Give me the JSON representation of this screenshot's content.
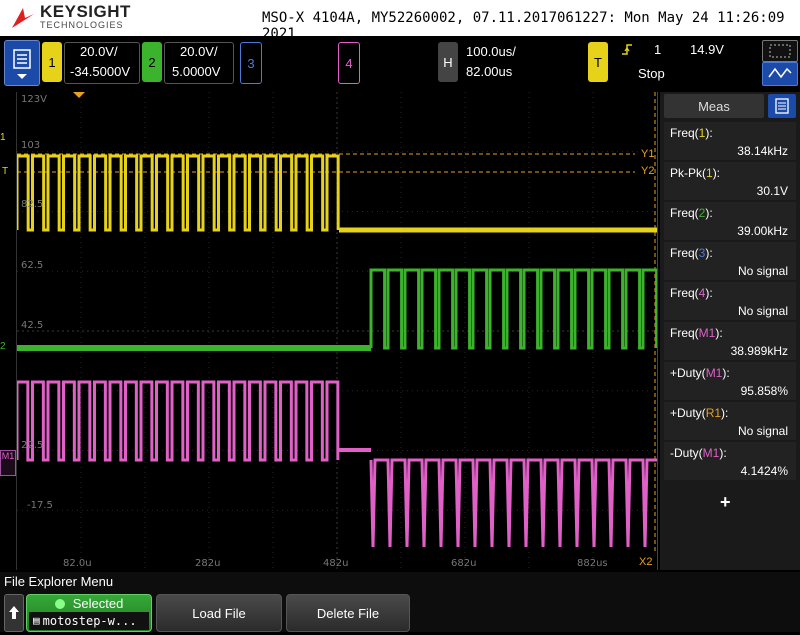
{
  "header": {
    "brand": "KEYSIGHT",
    "brand_sub": "TECHNOLOGIES",
    "instrument": "MSO-X 4104A, MY52260002, 07.11.2017061227: Mon May 24 11:26:09 2021"
  },
  "channels": [
    {
      "num": "1",
      "scale": "20.0V/",
      "offset": "-34.5000V",
      "color": "#e7d21a"
    },
    {
      "num": "2",
      "scale": "20.0V/",
      "offset": "5.0000V",
      "color": "#3cb32c"
    },
    {
      "num": "3",
      "color": "#4a7bd6"
    },
    {
      "num": "4",
      "color": "#e060c8"
    }
  ],
  "horizontal": {
    "label": "H",
    "timebase": "100.0us/",
    "delay": "82.00us"
  },
  "trigger": {
    "label": "T",
    "source": "1",
    "level": "14.9V",
    "state": "Stop",
    "icon": "rising-edge-icon"
  },
  "screen": {
    "y_ticks": [
      "123V",
      "103",
      "82.5",
      "62.5",
      "42.5",
      "22.5",
      "-17.5"
    ],
    "x_ticks": [
      "82.0u",
      "282u",
      "482u",
      "682u",
      "882us"
    ],
    "cursors": [
      "Y1",
      "Y2",
      "X2"
    ],
    "markers": [
      "1",
      "2",
      "M1",
      "T"
    ]
  },
  "measurements": {
    "title": "Meas",
    "items": [
      {
        "label": "Freq(",
        "src": "1",
        "end": "):",
        "value": "38.14kHz",
        "src_color": "#e7d21a"
      },
      {
        "label": "Pk-Pk(",
        "src": "1",
        "end": "):",
        "value": "30.1V",
        "src_color": "#e7d21a"
      },
      {
        "label": "Freq(",
        "src": "2",
        "end": "):",
        "value": "39.00kHz",
        "src_color": "#3cb32c"
      },
      {
        "label": "Freq(",
        "src": "3",
        "end": "):",
        "value": "No signal",
        "src_color": "#4a7bd6"
      },
      {
        "label": "Freq(",
        "src": "4",
        "end": "):",
        "value": "No signal",
        "src_color": "#e060c8"
      },
      {
        "label": "Freq(",
        "src": "M1",
        "end": "):",
        "value": "38.989kHz",
        "src_color": "#e060c8"
      },
      {
        "label": "+Duty(",
        "src": "M1",
        "end": "):",
        "value": "95.858%",
        "src_color": "#e060c8"
      },
      {
        "label": "+Duty(",
        "src": "R1",
        "end": "):",
        "value": "No signal",
        "src_color": "#e8a020"
      },
      {
        "label": "-Duty(",
        "src": "M1",
        "end": "):",
        "value": "4.1424%",
        "src_color": "#e060c8"
      }
    ],
    "add": "+"
  },
  "bottom": {
    "menu_title": "File Explorer Menu",
    "selected_label": "Selected",
    "selected_file": "motostep-w...",
    "load": "Load File",
    "delete": "Delete File"
  }
}
